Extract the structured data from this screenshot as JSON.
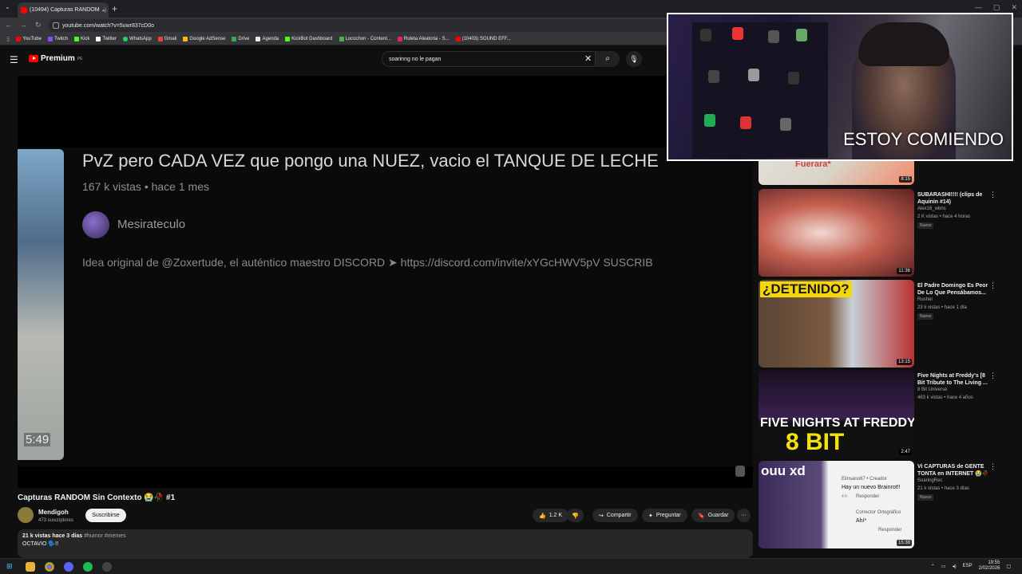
{
  "browser": {
    "tab_title": "(10494) Capturas RANDOM",
    "new_tab": "+",
    "url": "youtube.com/watch?v=5uwr837cD0o",
    "bookmarks": [
      "YouTube",
      "Twitch",
      "Kick",
      "Twitter",
      "WhatsApp",
      "Gmail",
      "Google AdSense",
      "Drive",
      "Agenda",
      "KickBot Dashboard",
      "Locochon - Content...",
      "Ruleta Aleatoria - S...",
      "(10403) SOUND EFF..."
    ]
  },
  "header": {
    "logo": "Premium",
    "logo_sup": "PE",
    "search_value": "soarinng no le pagan"
  },
  "player": {
    "embedded_title": "PvZ pero CADA VEZ que pongo una NUEZ, vacio el TANQUE DE LECHE",
    "embedded_meta": "167 k vistas • hace 1 mes",
    "embedded_channel": "Mesirateculo",
    "embedded_desc": "Idea original de @Zoxertude, el auténtico maestro DISCORD ➤ https://discord.com/invite/xYGcHWV5pV SUSCRIB",
    "thumb_duration": "5:49"
  },
  "video": {
    "title": "Capturas RANDOM Sin Contexto 😭🥀 #1",
    "channel": "Mendigoh",
    "subs": "473 suscriptores",
    "subscribe": "Suscribirse",
    "likes": "1.2 K",
    "share": "Compartir",
    "ask": "Preguntar",
    "save": "Guardar",
    "more": "···",
    "stats": "21 k vistas  hace 3 días",
    "tags": "#humor #memes",
    "desc": "OCTAVIO 🗣️!!"
  },
  "sidebar": [
    {
      "title": "",
      "channel": "",
      "meta": "",
      "badge": "",
      "duration": "8:15",
      "thumb_text": "Fuerara*"
    },
    {
      "title": "SUBARASHI!!!! (clips de Aquinin #14)",
      "channel": "Alex16_wbns",
      "meta": "2 K vistas • hace 4 horas",
      "badge": "Nuevo",
      "duration": "11:36",
      "thumb_text": ""
    },
    {
      "title": "El Padre Domingo Es Peor De Lo Que Pensábamos...",
      "channel": "Rusher",
      "meta": "23 k vistas • hace 1 día",
      "badge": "Nuevo",
      "duration": "13:15",
      "thumb_text": "¿DETENIDO?"
    },
    {
      "title": "Five Nights at Freddy's [8 Bit Tribute to The Living ...",
      "channel": "8 Bit Universe",
      "meta": "463 k vistas • hace 4 años",
      "badge": "",
      "duration": "2:47",
      "thumb_text": "FIVE NIGHTS AT FREDDYS"
    },
    {
      "title": "Vi CAPTURAS de GENTE TONTA en INTERNET 😭🥀",
      "channel": "SoaringRec",
      "meta": "21 k vistas • hace 3 días",
      "badge": "Nuevo",
      "duration": "15:38",
      "thumb_text": "ouu xd"
    }
  ],
  "thumb_extra": {
    "fnaf_sub": "8 BIT",
    "comment_user": "Elinsano67 • Creador",
    "comment_time": "4 h",
    "comment_text": "Hay un nuevo Brainrot!!",
    "reply": "Responder",
    "comment2_user": "Corrector Ortográfico",
    "comment2_text": "Ahí*"
  },
  "webcam": {
    "caption": "ESTOY COMIENDO"
  },
  "taskbar": {
    "lang": "ESP",
    "time": "19:55",
    "date": "2/02/2026"
  },
  "colors": {
    "youtube_red": "#ff0000",
    "background": "#0f0f0f",
    "pill": "#272727"
  }
}
